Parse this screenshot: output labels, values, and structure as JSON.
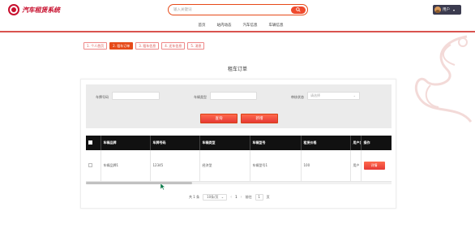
{
  "header": {
    "logo_text": "汽车租赁系统",
    "search_placeholder": "输入关键词",
    "user_name": "用户"
  },
  "nav": {
    "items": [
      "首页",
      "站内动态",
      "汽车信息",
      "车辆信息"
    ]
  },
  "tabs": [
    "个人首页",
    "租车订单",
    "租车信息",
    "还车信息",
    "消息"
  ],
  "page_title": "租车订单",
  "filter": {
    "plate_label": "车牌号码",
    "type_label": "车辆类型",
    "status_label": "审核状态",
    "status_placeholder": "请选择",
    "query_button": "查询",
    "reset_button": "新增"
  },
  "table": {
    "headers": [
      "车辆品牌",
      "车牌号码",
      "车辆类型",
      "车辆型号",
      "租赁价格",
      "用户名",
      "操作"
    ],
    "rows": [
      {
        "brand": "车辆品牌1",
        "plate": "12345",
        "type": "经济型",
        "model": "车辆型号1",
        "price": "100",
        "user": "用户",
        "action": "详情"
      }
    ]
  },
  "pagination": {
    "total": "共 1 条",
    "page_size": "10条/页",
    "prev": "‹",
    "current": "1",
    "next": "›",
    "goto_label": "前往",
    "goto_value": "1",
    "page_suffix": "页"
  },
  "colors": {
    "accent": "#e64a19",
    "nav_line": "#d9534f",
    "table_header": "#111111"
  }
}
